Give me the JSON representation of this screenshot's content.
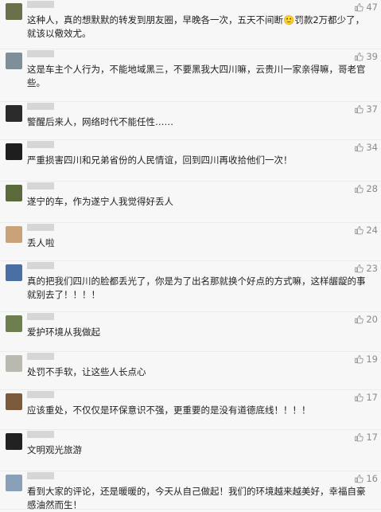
{
  "comments": [
    {
      "text": "这种人，真的想默默的转发到朋友圈，早晚各一次，五天不间断🙂罚款2万都少了，就该以儆效尤。",
      "likes": "47",
      "avatar_color": "#6b6f4a"
    },
    {
      "text": "这是车主个人行为，不能地域黑三，不要黑我大四川嘛，云贵川一家亲得嘛，哥老官些。",
      "likes": "39",
      "avatar_color": "#7f8f9a"
    },
    {
      "text": "警醒后来人，网络时代不能任性……",
      "likes": "37",
      "avatar_color": "#2b2b2b"
    },
    {
      "text": "严重损害四川和兄弟省份的人民情谊，回到四川再收拾他们一次！",
      "likes": "34",
      "avatar_color": "#1e1e1e"
    },
    {
      "text": "遂宁的车，作为遂宁人我觉得好丢人",
      "likes": "28",
      "avatar_color": "#5a6a3a"
    },
    {
      "text": "丢人啦",
      "likes": "24",
      "avatar_color": "#c9a27a"
    },
    {
      "text": "真的把我们四川的脸都丢光了，你是为了出名那就换个好点的方式嘛，这样龌龊的事就别去了！！！！",
      "likes": "23",
      "avatar_color": "#4a6fa5"
    },
    {
      "text": "爱护环境从我做起",
      "likes": "20",
      "avatar_color": "#6d7f4e"
    },
    {
      "text": "处罚不手软，让这些人长点心",
      "likes": "19",
      "avatar_color": "#b9b9b0"
    },
    {
      "text": "应该重处，不仅仅是环保意识不强，更重要的是没有道德底线！！！！",
      "likes": "17",
      "avatar_color": "#7a5a3a"
    },
    {
      "text": "文明观光旅游",
      "likes": "17",
      "avatar_color": "#222222"
    },
    {
      "text": "看到大家的评论，还是暖暖的，今天从自己做起！我们的环境越来越美好，幸福自豪感油然而生！",
      "likes": "16",
      "avatar_color": "#8aa0b8"
    }
  ],
  "icons": {
    "like": "thumbs-up-icon",
    "avatar": "user-avatar"
  }
}
